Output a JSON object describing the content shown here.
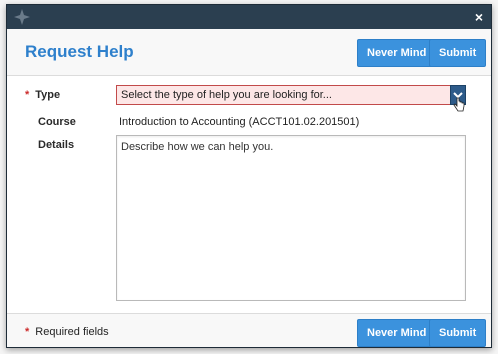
{
  "window": {
    "close_label": "×",
    "logo_icon": "brand-logo-icon"
  },
  "dialog": {
    "title": "Request Help",
    "never_mind_label": "Never Mind",
    "submit_label": "Submit"
  },
  "form": {
    "type": {
      "required_marker": "*",
      "label": "Type",
      "selected_value": "Select the type of help you are looking for...",
      "dropdown_icon": "chevron-down-icon"
    },
    "course": {
      "label": "Course",
      "value": "Introduction to Accounting (ACCT101.02.201501)"
    },
    "details": {
      "label": "Details",
      "placeholder": "Describe how we can help you."
    }
  },
  "footer": {
    "required_marker": "*",
    "required_note": "Required fields",
    "never_mind_label": "Never Mind",
    "submit_label": "Submit"
  },
  "colors": {
    "accent": "#3b92dd",
    "title": "#2e80cc",
    "titlebar": "#2b3f50",
    "error": "#cc2b2b"
  }
}
